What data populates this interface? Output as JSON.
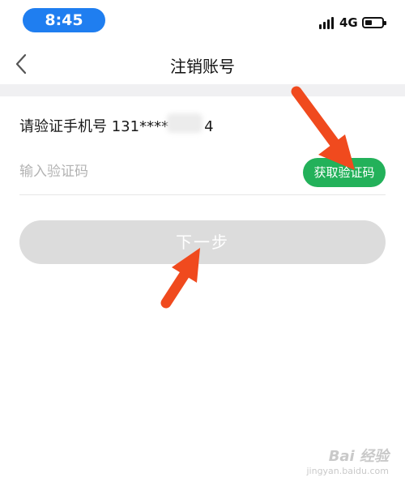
{
  "status_bar": {
    "time": "8:45",
    "network": "4G",
    "battery_level_fraction": 0.4,
    "icons": [
      "signal-icon",
      "battery-icon"
    ],
    "time_pill_color": "#1f7ef0"
  },
  "nav": {
    "back_icon": "chevron-left-icon",
    "title": "注销账号"
  },
  "form": {
    "phone_prompt": "请验证手机号 131****",
    "phone_suffix_visible": "4",
    "code_input": {
      "value": "",
      "placeholder": "输入验证码"
    },
    "get_code_label": "获取验证码",
    "next_label": "下一步"
  },
  "colors": {
    "accent_green": "#23b15a",
    "disabled_button": "#dcdcdc",
    "annotation_arrow": "#f04a1e"
  },
  "watermark": {
    "main": "Bai 经验",
    "sub": "jingyan.baidu.com"
  }
}
